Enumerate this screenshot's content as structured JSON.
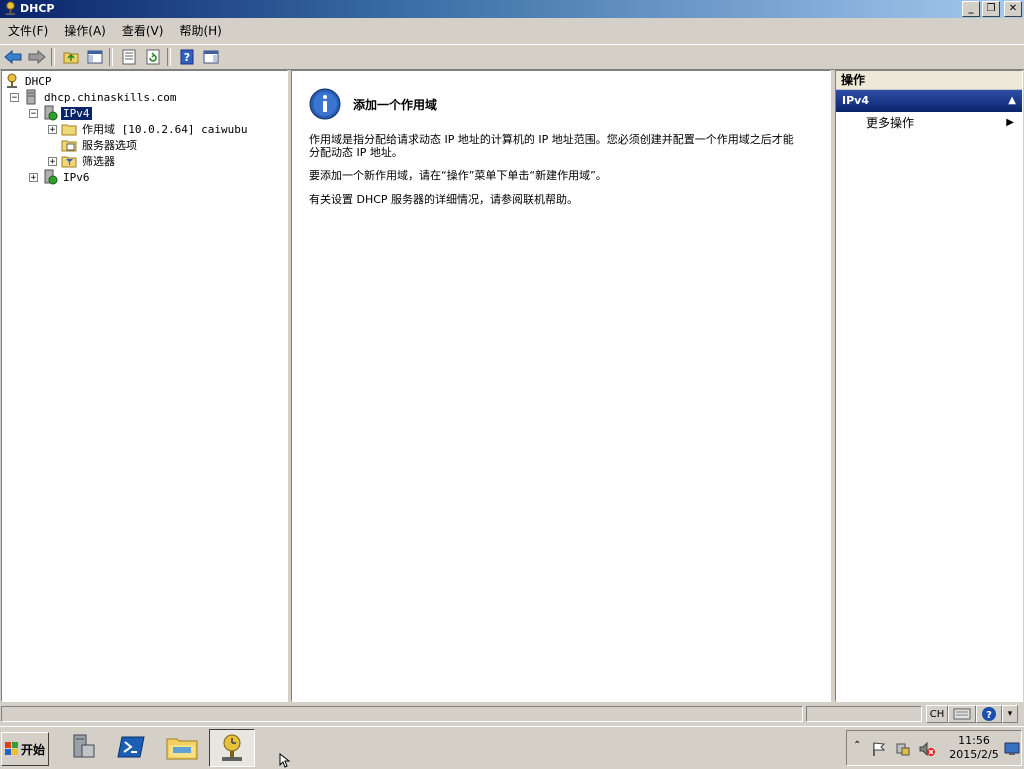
{
  "window": {
    "title": "DHCP"
  },
  "menu": [
    {
      "label": "文件(F)"
    },
    {
      "label": "操作(A)"
    },
    {
      "label": "查看(V)"
    },
    {
      "label": "帮助(H)"
    }
  ],
  "tree": {
    "root": "DHCP",
    "server": "dhcp.chinaskills.com",
    "ipv4": "IPv4",
    "scope": "作用域 [10.0.2.64] caiwubu",
    "server_options": "服务器选项",
    "filters": "筛选器",
    "ipv6": "IPv6"
  },
  "content": {
    "title": "添加一个作用域",
    "para1": "作用域是指分配给请求动态 IP 地址的计算机的 IP 地址范围。您必须创建并配置一个作用域之后才能分配动态 IP 地址。",
    "para2": "要添加一个新作用域，请在“操作”菜单下单击“新建作用域”。",
    "para3": "有关设置 DHCP 服务器的详细情况，请参阅联机帮助。"
  },
  "actions": {
    "header": "操作",
    "section": "IPv4",
    "more": "更多操作"
  },
  "taskbar": {
    "start_label": "开始",
    "ime_lang": "CH",
    "time": "11:56",
    "date": "2015/2/5"
  },
  "colors": {
    "title_active": "#0a246a",
    "selection": "#0a246a",
    "face": "#d4d0c8"
  }
}
